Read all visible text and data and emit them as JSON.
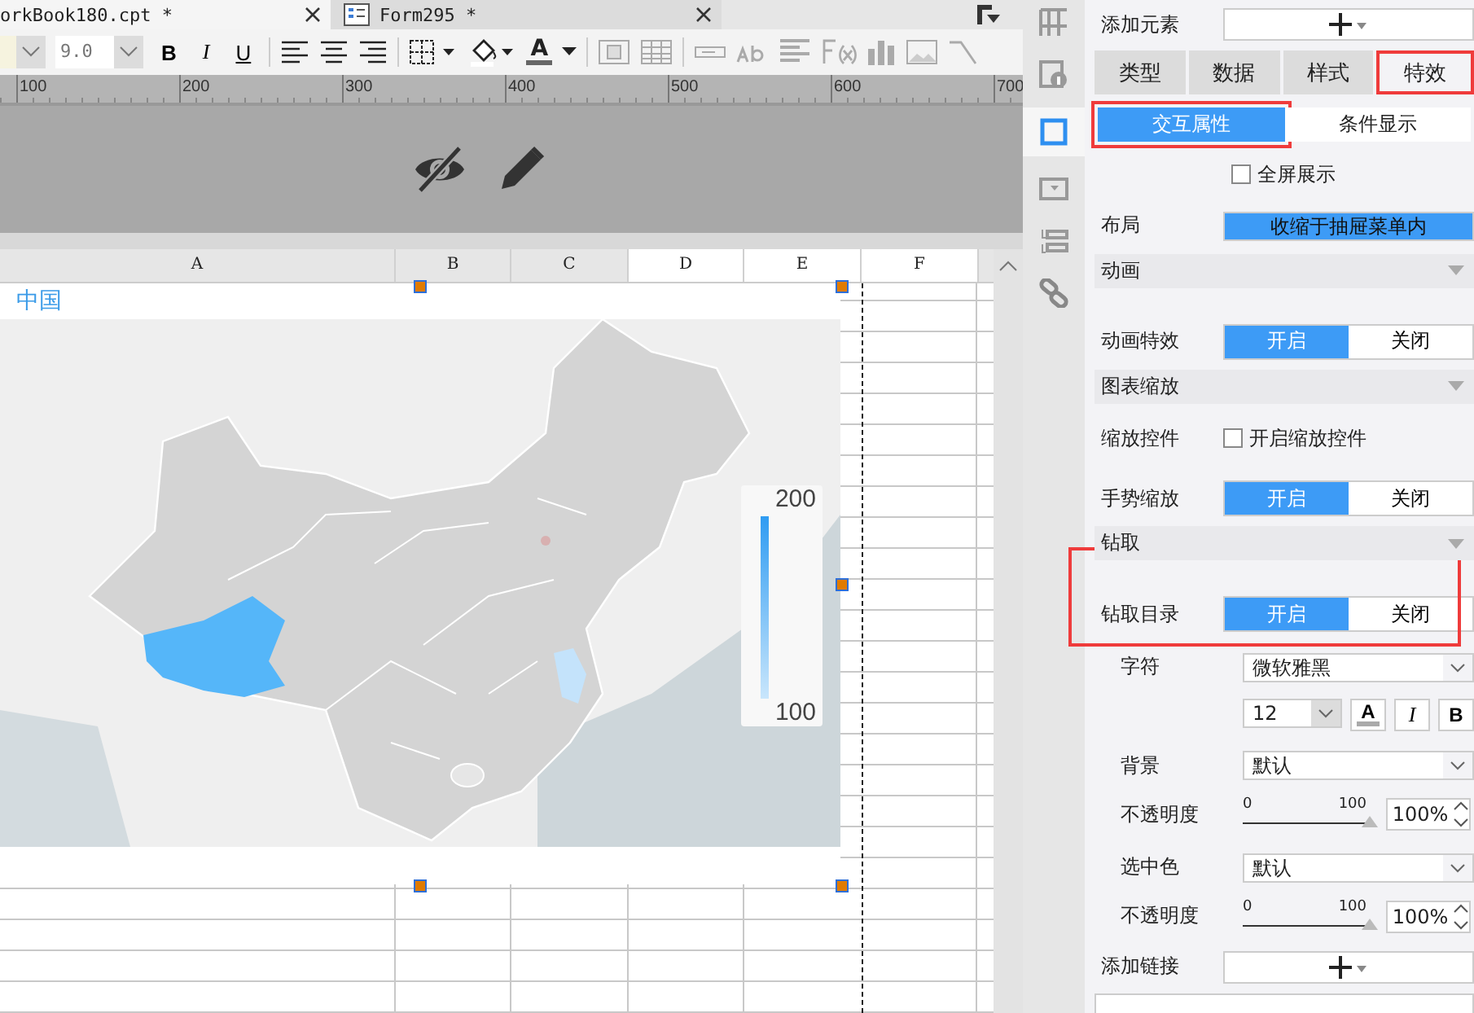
{
  "tabs": [
    {
      "label": "orkBook180.cpt *",
      "kind": "workbook",
      "selected": true
    },
    {
      "label": "Form295 *",
      "kind": "form",
      "selected": false
    }
  ],
  "toolbar": {
    "font_size": "9.0",
    "bold": "B",
    "italic": "I",
    "underline": "U",
    "font_color": "A"
  },
  "ruler": [
    "100",
    "200",
    "300",
    "400",
    "500",
    "600",
    "700"
  ],
  "columns": [
    {
      "label": "A",
      "selected": false
    },
    {
      "label": "B",
      "selected": false
    },
    {
      "label": "C",
      "selected": false
    },
    {
      "label": "D",
      "selected": true
    },
    {
      "label": "E",
      "selected": true
    },
    {
      "label": "F",
      "selected": true
    }
  ],
  "chart": {
    "title": "中国",
    "legend_max": "200",
    "legend_min": "100"
  },
  "side_icons": [
    {
      "kind": "layout",
      "selected": false
    },
    {
      "kind": "info",
      "selected": false
    },
    {
      "kind": "frame",
      "selected": true
    },
    {
      "kind": "dropdown",
      "selected": false
    },
    {
      "kind": "widget",
      "selected": false
    },
    {
      "kind": "link",
      "selected": false
    }
  ],
  "panel": {
    "add_element": "添加元素",
    "tabs": [
      {
        "label": "类型",
        "selected": false,
        "highlighted": false
      },
      {
        "label": "数据",
        "selected": false,
        "highlighted": false
      },
      {
        "label": "样式",
        "selected": false,
        "highlighted": false
      },
      {
        "label": "特效",
        "selected": true,
        "highlighted": true
      }
    ],
    "subtabs": [
      {
        "label": "交互属性",
        "selected": true,
        "highlighted": true
      },
      {
        "label": "条件显示",
        "selected": false,
        "highlighted": false
      }
    ],
    "fullscreen": {
      "label": "全屏展示",
      "checked": false
    },
    "layout": {
      "label": "布局",
      "value": "收缩于抽屉菜单内"
    },
    "sections": [
      {
        "title": "动画",
        "rows": [
          {
            "kind": "toggle",
            "label": "动画特效",
            "highlighted": false,
            "options": [
              {
                "label": "开启",
                "selected": true
              },
              {
                "label": "关闭",
                "selected": false
              }
            ]
          }
        ]
      },
      {
        "title": "图表缩放",
        "rows": [
          {
            "kind": "checkbox",
            "label": "缩放控件",
            "text": "开启缩放控件",
            "checked": false
          },
          {
            "kind": "toggle",
            "label": "手势缩放",
            "highlighted": false,
            "options": [
              {
                "label": "开启",
                "selected": true
              },
              {
                "label": "关闭",
                "selected": false
              }
            ]
          }
        ]
      },
      {
        "title": "钻取",
        "rows": [
          {
            "kind": "toggle",
            "label": "钻取目录",
            "highlighted": true,
            "options": [
              {
                "label": "开启",
                "selected": true
              },
              {
                "label": "关闭",
                "selected": false
              }
            ],
            "children": [
              {
                "kind": "select",
                "label": "字符",
                "value": "微软雅黑"
              },
              {
                "kind": "font",
                "size": "12",
                "font_color_label": "A",
                "italic": "I",
                "bold": "B"
              },
              {
                "kind": "select",
                "label": "背景",
                "value": "默认"
              },
              {
                "kind": "opacity",
                "label": "不透明度",
                "min": "0",
                "max": "100",
                "level": 1,
                "value": "100%"
              },
              {
                "kind": "select",
                "label": "选中色",
                "value": "默认"
              },
              {
                "kind": "opacity",
                "label": "不透明度",
                "min": "0",
                "max": "100",
                "level": 1,
                "value": "100%"
              }
            ]
          },
          {
            "kind": "add",
            "label": "添加链接"
          }
        ]
      }
    ]
  }
}
